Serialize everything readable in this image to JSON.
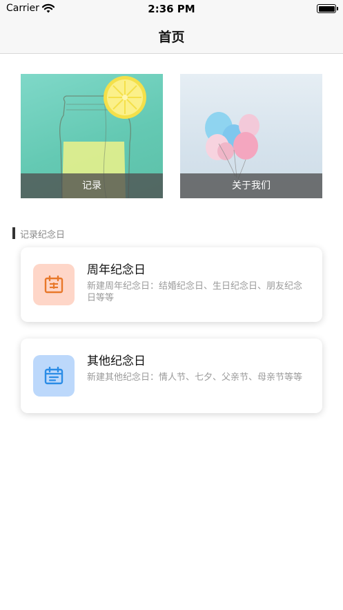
{
  "status_bar": {
    "carrier": "Carrier",
    "time": "2:36 PM"
  },
  "nav": {
    "title": "首页"
  },
  "tiles": [
    {
      "label": "记录",
      "image": "lemonade-jar-illustration"
    },
    {
      "label": "关于我们",
      "image": "balloons-photo"
    }
  ],
  "section": {
    "title": "记录纪念日"
  },
  "cards": [
    {
      "title": "周年纪念日",
      "description": "新建周年纪念日：结婚纪念日、生日纪念日、朋友纪念日等等",
      "icon": "calendar-icon",
      "icon_bg": "#fed6c8",
      "icon_color": "#e8782a"
    },
    {
      "title": "其他纪念日",
      "description": "新建其他纪念日：情人节、七夕、父亲节、母亲节等等",
      "icon": "calendar-icon",
      "icon_bg": "#bcd8fb",
      "icon_color": "#2a8ce6"
    }
  ]
}
